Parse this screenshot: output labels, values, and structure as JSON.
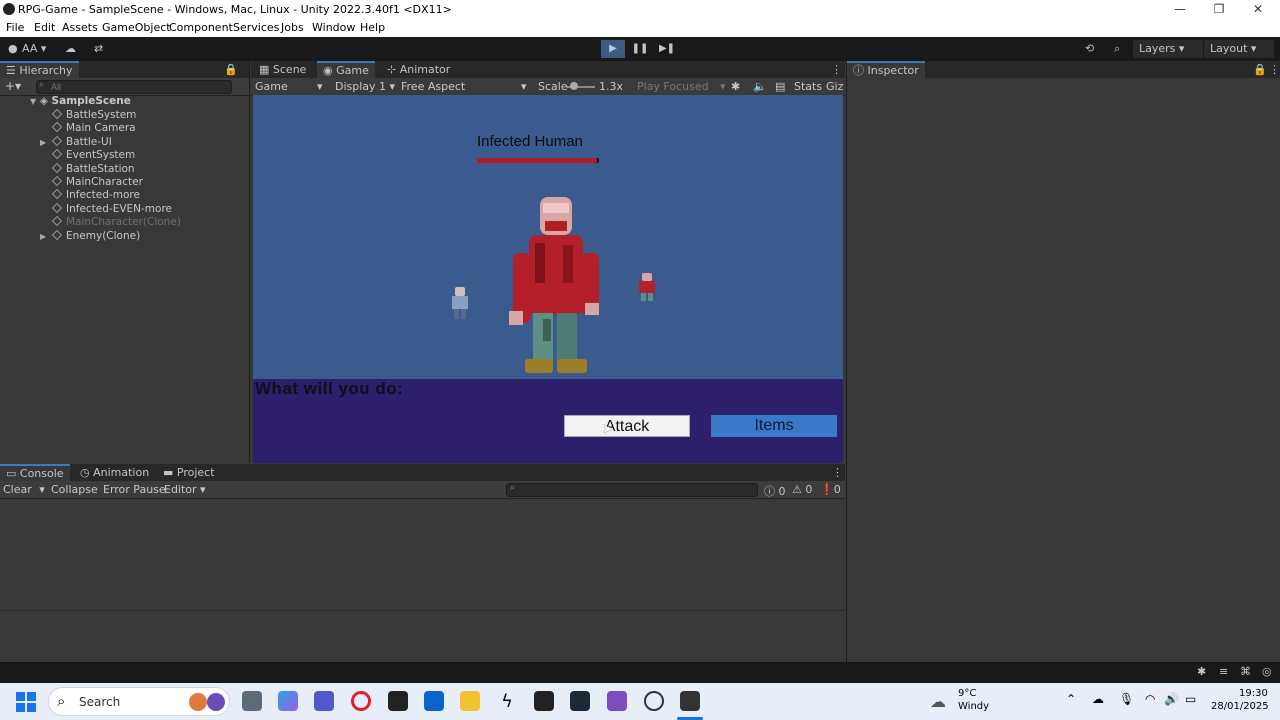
{
  "window": {
    "title": "RPG-Game - SampleScene - Windows, Mac, Linux - Unity 2022.3.40f1 <DX11>",
    "controls": [
      "—",
      "❐",
      "✕"
    ]
  },
  "menu": [
    "File",
    "Edit",
    "Assets",
    "GameObject",
    "Component",
    "Services",
    "Jobs",
    "Window",
    "Help"
  ],
  "toolbar": {
    "account": "AA",
    "layers_label": "Layers",
    "layout_label": "Layout"
  },
  "hierarchy": {
    "tab": "Hierarchy",
    "search_placeholder": "All",
    "scene": "SampleScene",
    "items": [
      {
        "label": "BattleSystem",
        "expandable": false,
        "dim": false
      },
      {
        "label": "Main Camera",
        "expandable": false,
        "dim": false
      },
      {
        "label": "Battle-UI",
        "expandable": true,
        "dim": false
      },
      {
        "label": "EventSystem",
        "expandable": false,
        "dim": false
      },
      {
        "label": "BattleStation",
        "expandable": false,
        "dim": false
      },
      {
        "label": "MainCharacter",
        "expandable": false,
        "dim": false
      },
      {
        "label": "Infected-more",
        "expandable": false,
        "dim": false
      },
      {
        "label": "Infected-EVEN-more",
        "expandable": false,
        "dim": false
      },
      {
        "label": "MainCharacter(Clone)",
        "expandable": false,
        "dim": true
      },
      {
        "label": "Enemy(Clone)",
        "expandable": true,
        "dim": false
      }
    ]
  },
  "center_tabs": [
    "Scene",
    "Game",
    "Animator"
  ],
  "game_toolbar": {
    "mode": "Game",
    "display": "Display 1",
    "aspect": "Free Aspect",
    "scale_label": "Scale",
    "scale_value": "1.3x",
    "play_focused": "Play Focused",
    "stats": "Stats",
    "gizmos": "Giz"
  },
  "game": {
    "enemy_name": "Infected Human",
    "hp_fraction": 0.98,
    "prompt": "What will you do:",
    "attack_label": "Attack",
    "items_label": "Items"
  },
  "inspector": {
    "tab": "Inspector"
  },
  "bottom_tabs": [
    "Console",
    "Animation",
    "Project"
  ],
  "console": {
    "clear": "Clear",
    "collapse": "Collapse",
    "error_pause": "Error Pause",
    "editor": "Editor",
    "count_logs": "0",
    "count_warnings": "0",
    "count_errors": "0"
  },
  "taskbar": {
    "search": "Search",
    "temp": "9°C",
    "weather": "Windy",
    "time": "19:30",
    "date": "28/01/2025"
  },
  "colors": {
    "game_bg": "#3b5b8f",
    "dialog_bg": "#2d1f6b",
    "attack_btn": "#f2f2f2",
    "items_btn": "#3a78c9",
    "hp_bar": "#b01c2a",
    "accent": "#3a79bb"
  }
}
